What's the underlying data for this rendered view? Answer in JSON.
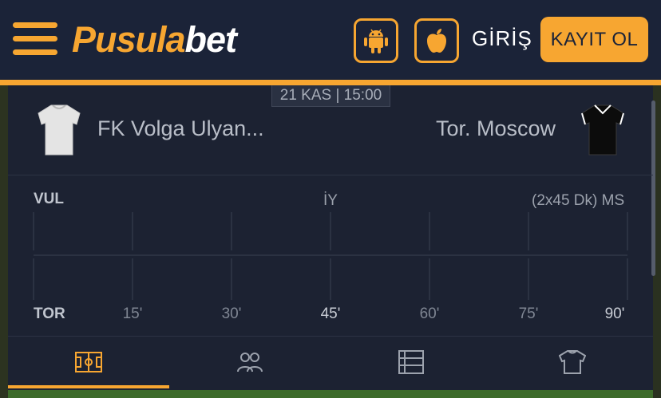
{
  "header": {
    "logo_part1": "Pusula",
    "logo_part2": "bet",
    "login_label": "GİRİŞ",
    "register_label": "KAYIT OL"
  },
  "match": {
    "date_time": "21 KAS | 15:00",
    "home_team": "FK Volga Ulyan...",
    "away_team": "Tor. Moscow"
  },
  "timeline": {
    "home_abbr": "VUL",
    "away_abbr": "TOR",
    "half_label": "İY",
    "full_label": "(2x45 Dk) MS",
    "ticks": [
      "15'",
      "30'",
      "45'",
      "60'",
      "75'",
      "90'"
    ]
  },
  "tabs": [
    {
      "icon": "field-icon",
      "active": true
    },
    {
      "icon": "players-icon",
      "active": false
    },
    {
      "icon": "list-icon",
      "active": false
    },
    {
      "icon": "jersey-icon",
      "active": false
    }
  ],
  "colors": {
    "accent": "#f7a631",
    "header_bg": "#1b2338",
    "panel_bg": "#1c2232"
  }
}
